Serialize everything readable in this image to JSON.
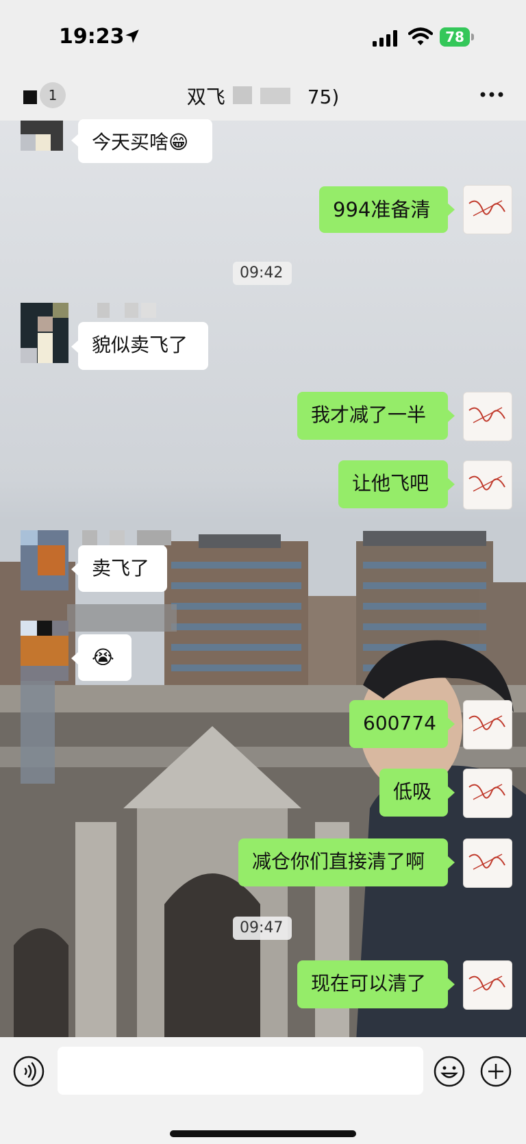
{
  "status_bar": {
    "time": "19:23",
    "battery": "78"
  },
  "nav": {
    "unread_count": "1",
    "title": "双飞",
    "title_suffix": "75)"
  },
  "messages": [
    {
      "side": "in",
      "text": "今天买啥😁"
    },
    {
      "side": "out",
      "text": "994准备清"
    },
    {
      "type": "time",
      "text": "09:42"
    },
    {
      "side": "in",
      "text": "貌似卖飞了"
    },
    {
      "side": "out",
      "text": "我才减了一半"
    },
    {
      "side": "out",
      "text": "让他飞吧"
    },
    {
      "side": "in",
      "text": "卖飞了"
    },
    {
      "side": "in",
      "text": "😭"
    },
    {
      "side": "out",
      "text": "600774"
    },
    {
      "side": "out",
      "text": "低吸"
    },
    {
      "side": "out",
      "text": "减仓你们直接清了啊"
    },
    {
      "type": "time",
      "text": "09:47"
    },
    {
      "side": "out",
      "text": "现在可以清了"
    }
  ],
  "my_avatar_text": "有故事的人",
  "colors": {
    "outgoing_bubble": "#95ec69",
    "incoming_bubble": "#ffffff",
    "battery": "#34c759"
  },
  "icons": [
    "location-arrow-icon",
    "signal-icon",
    "wifi-icon",
    "more-icon",
    "voice-icon",
    "emoji-icon",
    "plus-icon"
  ]
}
